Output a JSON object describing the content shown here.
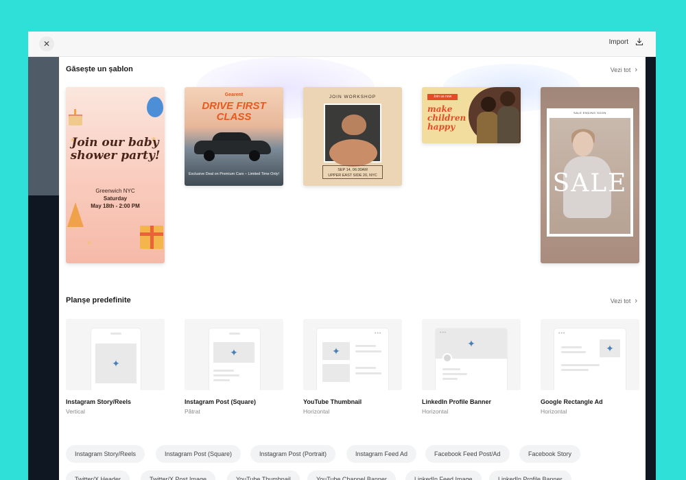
{
  "topbar": {
    "import_label": "Import"
  },
  "templates": {
    "title": "Găsește un șablon",
    "see_all": "Vezi tot",
    "cards": [
      {
        "name": "baby-shower",
        "heading": "Join our baby shower party!",
        "location": "Greenwich NYC",
        "day": "Saturday",
        "date": "May 18th - 2:00 PM"
      },
      {
        "name": "car-ad",
        "brand": "Gearent",
        "heading": "DRIVE FIRST CLASS",
        "sub": "Exclusive Deal on Premium Cars – Limited Time Only!"
      },
      {
        "name": "workshop",
        "title": "JOIN WORKSHOP",
        "info1": "SEP 14, 06:30AM",
        "info2": "UPPER EAST SIDE 20, NYC"
      },
      {
        "name": "charity",
        "tag": "Join us now",
        "heading": "make children happy"
      },
      {
        "name": "sale",
        "top": "SALE ENDING SOON",
        "word": "SALE"
      }
    ]
  },
  "presets": {
    "title": "Planșe predefinite",
    "see_all": "Vezi tot",
    "items": [
      {
        "label": "Instagram Story/Reels",
        "sub": "Vertical"
      },
      {
        "label": "Instagram Post (Square)",
        "sub": "Pătrat"
      },
      {
        "label": "YouTube Thumbnail",
        "sub": "Horizontal"
      },
      {
        "label": "LinkedIn Profile Banner",
        "sub": "Horizontal"
      },
      {
        "label": "Google Rectangle Ad",
        "sub": "Horizontal"
      }
    ]
  },
  "chips": [
    "Instagram Story/Reels",
    "Instagram Post (Square)",
    "Instagram Post (Portrait)",
    "Instagram Feed Ad",
    "Facebook Feed Post/Ad",
    "Facebook Story",
    "Twitter/X Header",
    "Twitter/X Post Image",
    "YouTube Thumbnail",
    "YouTube Channel Banner",
    "LinkedIn Feed Image",
    "LinkedIn Profile Banner"
  ],
  "icons": {
    "close": "close-icon",
    "import": "download-icon",
    "chevron": "chevron-right-icon",
    "sparkle": "sparkle-icon"
  },
  "colors": {
    "background": "#2ee0d8",
    "accent_sparkle": "#4a7fb8"
  }
}
